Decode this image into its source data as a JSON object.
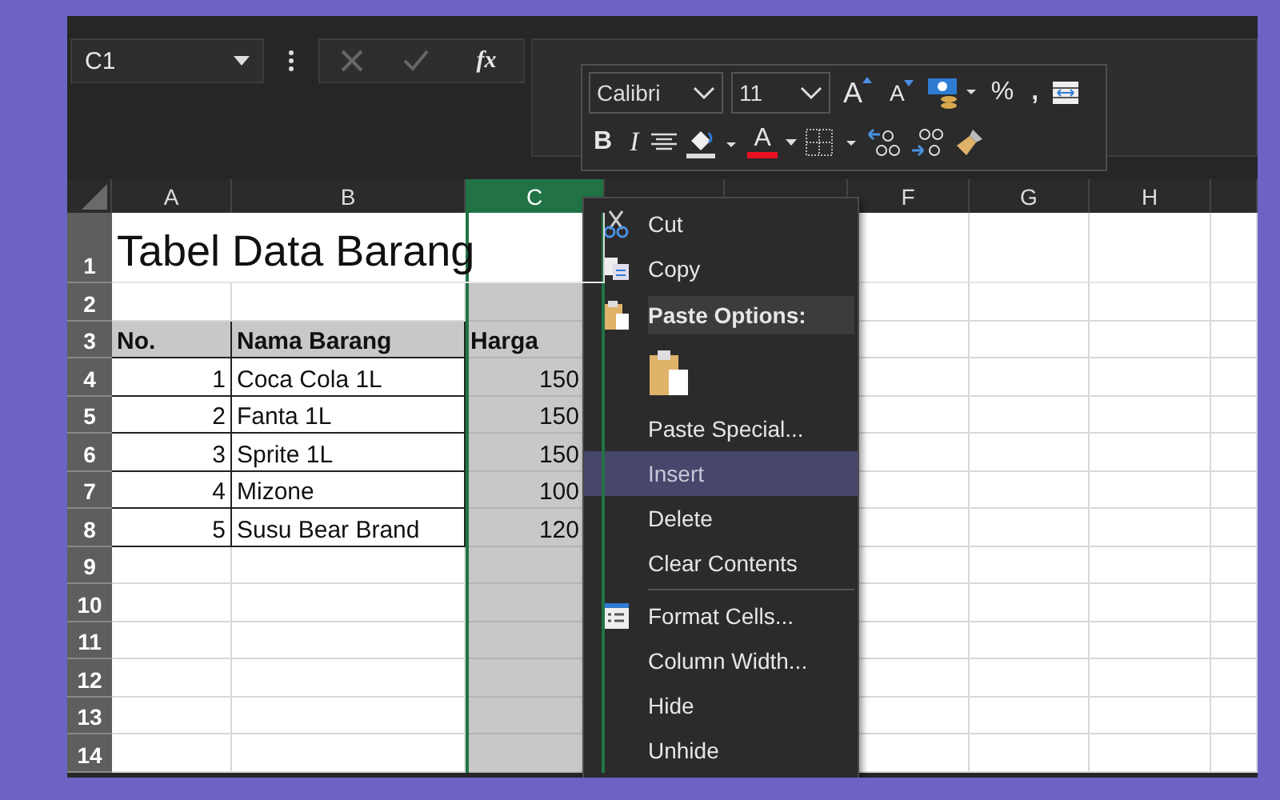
{
  "name_box": {
    "value": "C1"
  },
  "formula_bar": {
    "function_label": "fx"
  },
  "mini_toolbar": {
    "font": "Calibri",
    "size": "11",
    "grow_font": "A",
    "shrink_font": "A",
    "percent": "%",
    "comma": ",",
    "bold": "B",
    "italic": "I",
    "font_color": "A"
  },
  "columns": [
    {
      "label": "A",
      "selected": false
    },
    {
      "label": "B",
      "selected": false
    },
    {
      "label": "C",
      "selected": true
    },
    {
      "selected": false
    },
    {
      "selected": false
    },
    {
      "label": "F",
      "selected": false
    },
    {
      "label": "G",
      "selected": false
    },
    {
      "label": "H",
      "selected": false
    }
  ],
  "rows": [
    {
      "label": "1",
      "kind": "title",
      "cells": [
        "Tabel Data Barang"
      ]
    },
    {
      "label": "2",
      "kind": "empty",
      "cells": []
    },
    {
      "label": "3",
      "kind": "header",
      "cells": [
        "No.",
        "Nama Barang",
        "Harga"
      ]
    },
    {
      "label": "4",
      "kind": "data",
      "cells": [
        "1",
        "Coca Cola 1L",
        "150"
      ]
    },
    {
      "label": "5",
      "kind": "data",
      "cells": [
        "2",
        "Fanta 1L",
        "150"
      ]
    },
    {
      "label": "6",
      "kind": "data",
      "cells": [
        "3",
        "Sprite 1L",
        "150"
      ]
    },
    {
      "label": "7",
      "kind": "data",
      "cells": [
        "4",
        "Mizone",
        "100"
      ]
    },
    {
      "label": "8",
      "kind": "data",
      "cells": [
        "5",
        "Susu Bear Brand",
        "120"
      ]
    },
    {
      "label": "9",
      "kind": "empty",
      "cells": []
    },
    {
      "label": "10",
      "kind": "empty",
      "cells": []
    },
    {
      "label": "11",
      "kind": "empty",
      "cells": []
    },
    {
      "label": "12",
      "kind": "empty",
      "cells": []
    },
    {
      "label": "13",
      "kind": "empty",
      "cells": []
    },
    {
      "label": "14",
      "kind": "empty",
      "cells": []
    }
  ],
  "context_menu": [
    {
      "kind": "cut",
      "label": "Cut",
      "selected": false
    },
    {
      "kind": "copy",
      "label": "Copy",
      "selected": false
    },
    {
      "kind": "header",
      "label": "Paste Options:"
    },
    {
      "kind": "paste-icons"
    },
    {
      "kind": "item",
      "label": "Paste Special...",
      "selected": false
    },
    {
      "kind": "item",
      "label": "Insert",
      "selected": true
    },
    {
      "kind": "item",
      "label": "Delete",
      "selected": false
    },
    {
      "kind": "item",
      "label": "Clear Contents",
      "selected": false
    },
    {
      "kind": "separator"
    },
    {
      "kind": "format",
      "label": "Format Cells...",
      "selected": false
    },
    {
      "kind": "item",
      "label": "Column Width...",
      "selected": false
    },
    {
      "kind": "item",
      "label": "Hide",
      "selected": false
    },
    {
      "kind": "item",
      "label": "Unhide",
      "selected": false
    }
  ]
}
